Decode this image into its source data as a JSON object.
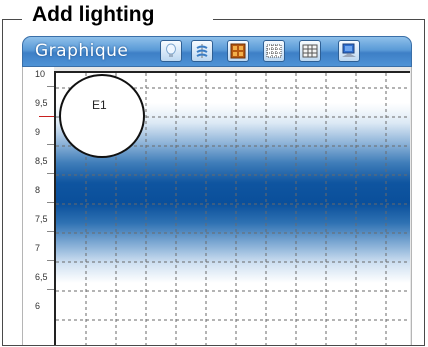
{
  "group": {
    "title": "Add lighting"
  },
  "toolbar": {
    "title": "Graphique",
    "buttons": [
      {
        "name": "lightbulb-icon"
      },
      {
        "name": "rotate-light-icon"
      },
      {
        "name": "window-icon"
      },
      {
        "name": "grid-dotted-icon"
      },
      {
        "name": "grid-solid-icon"
      },
      {
        "name": "monitor-icon"
      }
    ]
  },
  "axis": {
    "y_ticks": [
      "10",
      "9,5",
      "9",
      "8,5",
      "8",
      "7,5",
      "7",
      "6,5",
      "6"
    ]
  },
  "emitter": {
    "label": "E1"
  },
  "colors": {
    "toolbar": "#4f93d6",
    "light_band": "#0a4f9b",
    "marker": "#c8201f"
  }
}
